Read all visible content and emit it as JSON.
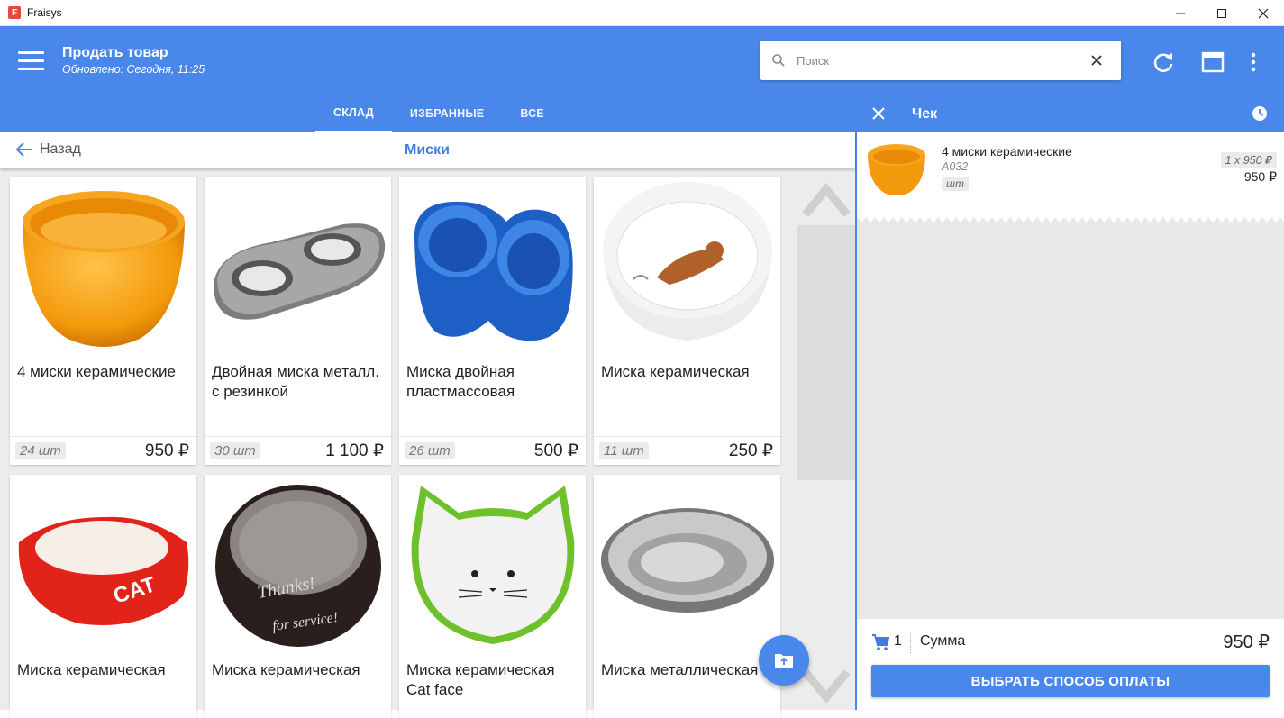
{
  "window": {
    "app_name": "Fraisys",
    "logo_letter": "F"
  },
  "header": {
    "title": "Продать товар",
    "subtitle": "Обновлено: Сегодня, 11:25",
    "search_placeholder": "Поиск",
    "accent_color": "#4a87ea"
  },
  "tabs": [
    {
      "label": "СКЛАД",
      "active": true
    },
    {
      "label": "ИЗБРАННЫЕ",
      "active": false
    },
    {
      "label": "ВСЕ",
      "active": false
    }
  ],
  "navbar": {
    "back_label": "Назад",
    "category": "Миски"
  },
  "products": [
    {
      "name": "4 миски керамические",
      "stock": "24 шт",
      "price": "950 ₽",
      "image": "orange-ceramic-bowl"
    },
    {
      "name": "Двойная миска металл. с резинкой",
      "stock": "30 шт",
      "price": "1 100 ₽",
      "image": "double-steel-bowl"
    },
    {
      "name": "Миска двойная пластмассовая",
      "stock": "26 шт",
      "price": "500 ₽",
      "image": "blue-plastic-double-bowl"
    },
    {
      "name": "Миска керамическая",
      "stock": "11 шт",
      "price": "250 ₽",
      "image": "white-cat-print-bowl"
    },
    {
      "name": "Миска керамическая",
      "image": "red-cat-bowl"
    },
    {
      "name": "Миска керамическая",
      "image": "black-thanks-bowl"
    },
    {
      "name": "Миска керамическая Cat face",
      "image": "cat-face-bowl"
    },
    {
      "name": "Миска металлическая",
      "image": "steel-bowl"
    }
  ],
  "receipt": {
    "title": "Чек",
    "items": [
      {
        "name": "4 миски керамические",
        "sku": "A032",
        "unit": "шт",
        "qty_price": "1 x 950 ₽",
        "total": "950 ₽"
      }
    ],
    "cart_count": "1",
    "sum_label": "Сумма",
    "sum_value": "950 ₽",
    "pay_button": "ВЫБРАТЬ СПОСОБ ОПЛАТЫ"
  }
}
